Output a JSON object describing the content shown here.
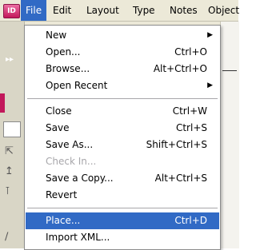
{
  "app": {
    "icon_text": "ID"
  },
  "menubar": {
    "items": [
      {
        "label": "File"
      },
      {
        "label": "Edit"
      },
      {
        "label": "Layout"
      },
      {
        "label": "Type"
      },
      {
        "label": "Notes"
      },
      {
        "label": "Object"
      }
    ],
    "active": "File"
  },
  "file_menu": {
    "items": [
      {
        "label": "New",
        "shortcut": "",
        "submenu": true
      },
      {
        "label": "Open...",
        "shortcut": "Ctrl+O"
      },
      {
        "label": "Browse...",
        "shortcut": "Alt+Ctrl+O"
      },
      {
        "label": "Open Recent",
        "shortcut": "",
        "submenu": true
      },
      {
        "label": "Close",
        "shortcut": "Ctrl+W"
      },
      {
        "label": "Save",
        "shortcut": "Ctrl+S"
      },
      {
        "label": "Save As...",
        "shortcut": "Shift+Ctrl+S"
      },
      {
        "label": "Check In...",
        "shortcut": "",
        "disabled": true
      },
      {
        "label": "Save a Copy...",
        "shortcut": "Alt+Ctrl+S"
      },
      {
        "label": "Revert",
        "shortcut": ""
      },
      {
        "label": "Place...",
        "shortcut": "Ctrl+D",
        "selected": true
      },
      {
        "label": "Import XML...",
        "shortcut": ""
      }
    ]
  },
  "colors": {
    "selection": "#316ac5",
    "menubar_bg": "#ece9d8",
    "disabled_text": "#a7a6aa",
    "app_icon": "#c2185b"
  }
}
